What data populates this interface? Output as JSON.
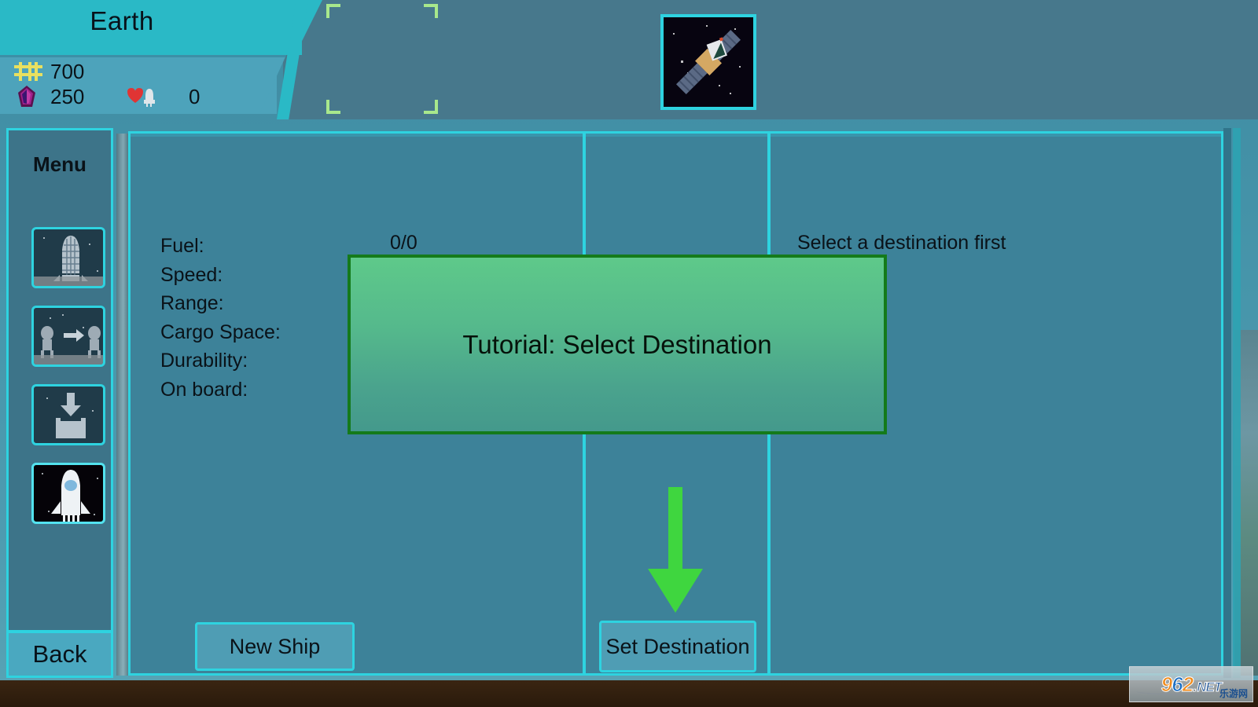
{
  "header": {
    "planet_name": "Earth",
    "resources": [
      {
        "icon": "credits-icon",
        "value": "700"
      },
      {
        "icon": "crystal-icon",
        "value": "250"
      }
    ],
    "fleet": {
      "icon": "heart-ship-icon",
      "value": "0"
    },
    "ship_thumbnail": {
      "name": "satellite-thumbnail",
      "selected": true
    }
  },
  "sidebar": {
    "title": "Menu",
    "items": [
      {
        "name": "sidebar-item-shipyard",
        "icon": "rocket-tower-icon",
        "selected": false
      },
      {
        "name": "sidebar-item-crew-transfer",
        "icon": "crew-transfer-icon",
        "selected": false
      },
      {
        "name": "sidebar-item-cargo",
        "icon": "cargo-load-icon",
        "selected": false
      },
      {
        "name": "sidebar-item-launch",
        "icon": "rocket-launch-icon",
        "selected": true
      }
    ],
    "back_label": "Back"
  },
  "main": {
    "stats": [
      {
        "label": "Fuel:",
        "value": "0/0"
      },
      {
        "label": "Speed:",
        "value": ""
      },
      {
        "label": "Range:",
        "value": ""
      },
      {
        "label": "Cargo Space:",
        "value": ""
      },
      {
        "label": "Durability:",
        "value": ""
      },
      {
        "label": "On board:",
        "value": ""
      }
    ],
    "fuel_value": "0/0",
    "destination_message": "Select a destination first",
    "new_ship_label": "New Ship",
    "set_destination_label": "Set Destination"
  },
  "tutorial": {
    "text": "Tutorial: Select Destination",
    "arrow": "down-arrow-hint"
  },
  "watermark": {
    "digits_9": "9",
    "digits_6": "6",
    "digits_2": "2",
    "dot": ".",
    "net": "NET",
    "cn": "乐游网"
  },
  "colors": {
    "header_cyan": "#2ab9c6",
    "panel_blue": "#3d8299",
    "accent_cyan": "#2ed3e0",
    "tutorial_green_top": "#5ec98a",
    "tutorial_green_bottom": "#44998c",
    "tutorial_border": "#147a1a",
    "arrow_green": "#3fd63f",
    "text_dark": "#0a1218"
  }
}
